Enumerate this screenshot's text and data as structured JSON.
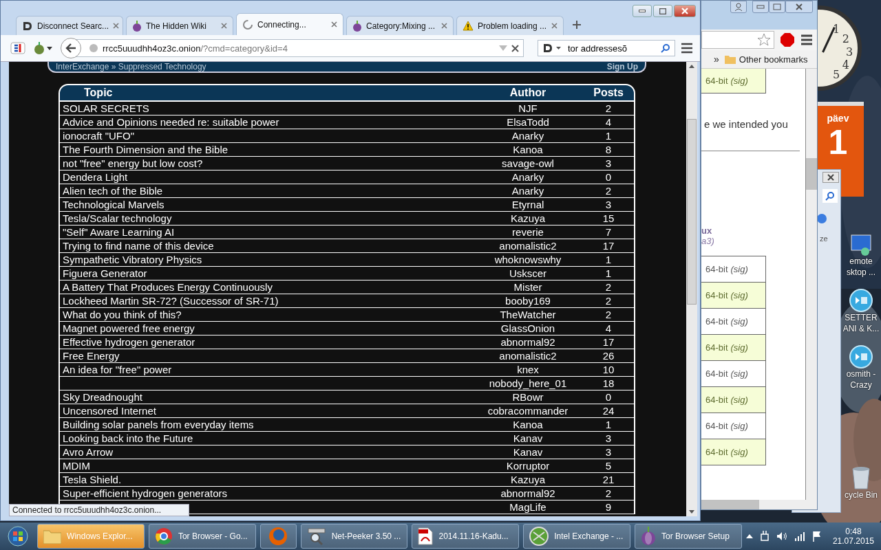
{
  "browser": {
    "tabs": [
      {
        "label": "Disconnect Searc...",
        "kind": "search-engine",
        "selected": false
      },
      {
        "label": "The Hidden Wiki",
        "kind": "onion-site",
        "selected": false
      },
      {
        "label": "Connecting...",
        "kind": "loading",
        "selected": true
      },
      {
        "label": "Category:Mixing ...",
        "kind": "onion-site",
        "selected": false
      },
      {
        "label": "Problem loading ...",
        "kind": "error",
        "selected": false
      }
    ],
    "url_host": "rrcc5uuudhh4oz3c.onion",
    "url_path": "/?cmd=category&id=4",
    "search": {
      "value": "tor addressesõ"
    },
    "status": "Connected to rrcc5uuudhh4oz3c.onion...",
    "page": {
      "breadcrumb": "InterExchange » Suppressed Technology",
      "sign_up": "Sign Up",
      "columns": [
        "Topic",
        "Author",
        "Posts"
      ],
      "rows": [
        {
          "topic": "SOLAR SECRETS",
          "author": "NJF",
          "posts": "2"
        },
        {
          "topic": "Advice and Opinions needed re: suitable power",
          "author": "ElsaTodd",
          "posts": "4"
        },
        {
          "topic": "ionocraft \"UFO\"",
          "author": "Anarky",
          "posts": "1"
        },
        {
          "topic": "The Fourth Dimension and the Bible",
          "author": "Kanoa",
          "posts": "8"
        },
        {
          "topic": "not \"free\" energy but low cost?",
          "author": "savage-owl",
          "posts": "3"
        },
        {
          "topic": "Dendera Light",
          "author": "Anarky",
          "posts": "0"
        },
        {
          "topic": "Alien tech of the Bible",
          "author": "Anarky",
          "posts": "2"
        },
        {
          "topic": "Technological Marvels",
          "author": "Etyrnal",
          "posts": "3"
        },
        {
          "topic": "Tesla/Scalar technology",
          "author": "Kazuya",
          "posts": "15"
        },
        {
          "topic": "\"Self\" Aware Learning AI",
          "author": "reverie",
          "posts": "7"
        },
        {
          "topic": "Trying to find name of this device",
          "author": "anomalistic2",
          "posts": "17"
        },
        {
          "topic": "Sympathetic Vibratory Physics",
          "author": "whoknowswhy",
          "posts": "1"
        },
        {
          "topic": "Figuera Generator",
          "author": "Uskscer",
          "posts": "1"
        },
        {
          "topic": "A Battery That Produces Energy Continuously",
          "author": "Mister",
          "posts": "2"
        },
        {
          "topic": "Lockheed Martin SR-72? (Successor of SR-71)",
          "author": "booby169",
          "posts": "2"
        },
        {
          "topic": "What do you think of this?",
          "author": "TheWatcher",
          "posts": "2"
        },
        {
          "topic": "Magnet powered free energy",
          "author": "GlassOnion",
          "posts": "4"
        },
        {
          "topic": "Effective hydrogen generator",
          "author": "abnormal92",
          "posts": "17"
        },
        {
          "topic": "Free Energy",
          "author": "anomalistic2",
          "posts": "26"
        },
        {
          "topic": "An idea for \"free\" power",
          "author": "knex",
          "posts": "10"
        },
        {
          "author": "nobody_here_01",
          "posts": "18"
        },
        {
          "topic": "Sky Dreadnought",
          "author": "RBowr",
          "posts": "0"
        },
        {
          "topic": "Uncensored Internet",
          "author": "cobracommander",
          "posts": "24"
        },
        {
          "topic": "Building solar panels from everyday items",
          "author": "Kanoa",
          "posts": "1"
        },
        {
          "topic": "Looking back into the Future",
          "author": "Kanav",
          "posts": "3"
        },
        {
          "topic": "Avro Arrow",
          "author": "Kanav",
          "posts": "3"
        },
        {
          "topic": "MDIM",
          "author": "Korruptor",
          "posts": "5"
        },
        {
          "topic": "Tesla Shield.",
          "author": "Kazuya",
          "posts": "21"
        },
        {
          "topic": "Super-efficient hydrogen generators",
          "author": "abnormal92",
          "posts": "2"
        },
        {
          "author": "MagLife",
          "posts": "9"
        }
      ]
    }
  },
  "back_window": {
    "bookmarks_chevron": "»",
    "bookmarks": "Other bookmarks",
    "text_1": "e we intended you",
    "text_2": "ux",
    "text_3": "a3)",
    "downloads": [
      {
        "label": "64-bit",
        "sig": "(sig)",
        "highlighted": true
      },
      {
        "label": "64-bit",
        "sig": "(sig)",
        "highlighted": false
      },
      {
        "label": "64-bit",
        "sig": "(sig)",
        "highlighted": true
      },
      {
        "label": "64-bit",
        "sig": "(sig)",
        "highlighted": false
      },
      {
        "label": "64-bit",
        "sig": "(sig)",
        "highlighted": true
      },
      {
        "label": "64-bit",
        "sig": "(sig)",
        "highlighted": false
      },
      {
        "label": "64-bit",
        "sig": "(sig)",
        "highlighted": true
      },
      {
        "label": "64-bit",
        "sig": "(sig)",
        "highlighted": false
      },
      {
        "label": "64-bit",
        "sig": "(sig)",
        "highlighted": true
      }
    ]
  },
  "small_window": {
    "text": "ze"
  },
  "clock": {
    "numerals": [
      "1",
      "2",
      "3",
      "4",
      "5"
    ]
  },
  "calendar": {
    "weekday": "päev",
    "day": "1"
  },
  "desktop_icons": [
    {
      "kind": "remote",
      "lines": [
        "emote",
        "sktop ..."
      ]
    },
    {
      "kind": "player",
      "lines": [
        "SETTER",
        "ANI & K..."
      ]
    },
    {
      "kind": "player",
      "lines": [
        "osmith -",
        "Crazy"
      ]
    },
    {
      "kind": "bin",
      "lines": [
        "cycle Bin"
      ]
    }
  ],
  "taskbar": {
    "items": [
      {
        "label": "Windows Explor...",
        "kind": "explorer",
        "selected": true
      },
      {
        "label": "Tor Browser - Go...",
        "kind": "chrome",
        "selected": false
      },
      {
        "kind": "firefox",
        "selected": false
      },
      {
        "label": "Net-Peeker 3.50 ...",
        "kind": "netpeeker",
        "selected": false
      },
      {
        "label": "2014.11.16-Kadu...",
        "kind": "pdf",
        "selected": false
      },
      {
        "label": "Intel Exchange - ...",
        "kind": "web",
        "selected": false
      },
      {
        "label": "Tor Browser Setup",
        "kind": "installer",
        "selected": false
      }
    ],
    "time": "0:48",
    "date": "21.07.2015"
  }
}
